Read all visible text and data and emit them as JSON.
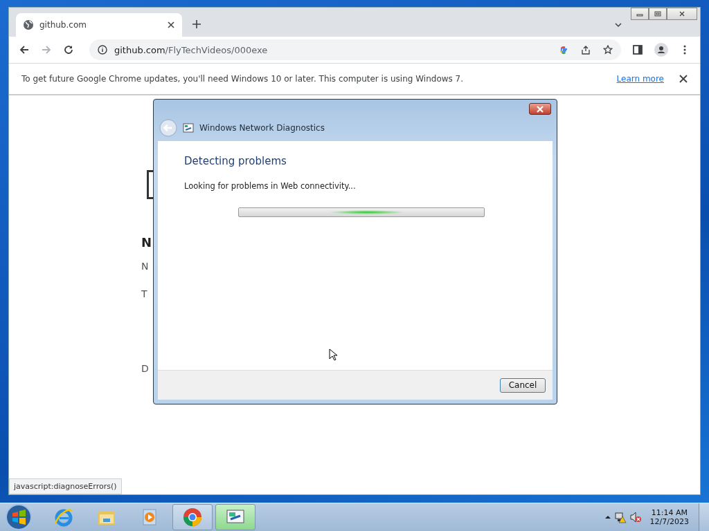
{
  "browser": {
    "tabs": [
      {
        "title": "github.com",
        "selected": true
      }
    ],
    "address": {
      "host": "github.com",
      "path": "/FlyTechVideos/000exe"
    },
    "infobar": {
      "message": "To get future Google Chrome updates, you'll need Windows 10 or later. This computer is using Windows 7.",
      "link": "Learn more"
    },
    "page_fragments": [
      {
        "kind": "heading",
        "text": "N"
      },
      {
        "kind": "text",
        "text": "N"
      },
      {
        "kind": "text",
        "text": "T"
      },
      {
        "kind": "text",
        "text": "D"
      }
    ],
    "status_url": "javascript:diagnoseErrors()"
  },
  "dialog": {
    "title": "Windows Network Diagnostics",
    "heading": "Detecting problems",
    "message": "Looking for problems in Web connectivity...",
    "progress": {
      "indeterminate": true
    },
    "buttons": [
      "Cancel"
    ]
  },
  "taskbar": {
    "apps": [
      {
        "kind": "ie",
        "running": false,
        "active": false
      },
      {
        "kind": "explorer",
        "running": false,
        "active": false
      },
      {
        "kind": "media",
        "running": false,
        "active": false
      },
      {
        "kind": "chrome",
        "running": true,
        "active": false
      },
      {
        "kind": "network",
        "running": true,
        "active": true
      }
    ],
    "time": "11:14 AM",
    "date": "12/7/2023"
  }
}
